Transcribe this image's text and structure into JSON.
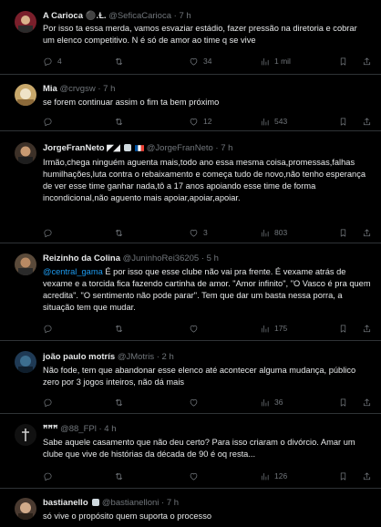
{
  "tweets": [
    {
      "name": "A Carioca",
      "name_suffix": "⚫.Ɫ.",
      "handle": "@SeficaCarioca",
      "time": "7 h",
      "text": "Por isso ta essa merda, vamos esvaziar estádio, fazer pressão na diretoria e cobrar um elenco competitivo. N é só de amor ao time q se vive",
      "replies": "4",
      "retweets": "",
      "likes": "34",
      "views": "1 mil"
    },
    {
      "name": "Mia",
      "name_suffix": "",
      "handle": "@crvgsw",
      "time": "7 h",
      "text": "se forem continuar assim o fim ta bem próximo",
      "replies": "",
      "retweets": "",
      "likes": "12",
      "views": "543"
    },
    {
      "name": "JorgeFranNeto",
      "name_suffix": "◤◢",
      "handle": "@JorgeFranNeto",
      "time": "7 h",
      "text": "Irmão,chega ninguém aguenta mais,todo ano essa mesma coisa,promessas,falhas humilhações,luta contra o rebaixamento e começa tudo de novo,não tenho esperança de ver esse time ganhar nada,tô a 17 anos apoiando esse time de forma incondicional,não aguento mais apoiar,apoiar,apoiar.",
      "replies": "",
      "retweets": "",
      "likes": "3",
      "views": "803"
    },
    {
      "name": "Reizinho da Colina",
      "name_suffix": "",
      "handle": "@JuninhoRei36205",
      "time": "5 h",
      "mention": "@central_gama",
      "text": " É por isso que esse clube não vai pra frente. É vexame atrás de vexame e a torcida fica fazendo cartinha de amor. \"Amor infinito\", \"O Vasco é pra quem acredita\". \"O sentimento não pode parar\". Tem que dar um basta nessa porra, a situação tem que mudar.",
      "replies": "",
      "retweets": "",
      "likes": "",
      "views": "175"
    },
    {
      "name": "joão paulo motrís",
      "name_suffix": "",
      "handle": "@JMotris",
      "time": "2 h",
      "text": "Não fode, tem que abandonar esse elenco até acontecer alguma mudança, público zero por 3 jogos inteiros, não dá mais",
      "replies": "",
      "retweets": "",
      "likes": "",
      "views": "36"
    },
    {
      "name": "ꟸꟸꟸ",
      "name_suffix": "",
      "handle": "@88_FPl",
      "time": "4 h",
      "text": "Sabe aquele casamento que não deu certo? Para isso criaram o divórcio. Amar um clube que vive de histórias da década de 90 é oq resta...",
      "replies": "",
      "retweets": "",
      "likes": "",
      "views": "126"
    },
    {
      "name": "bastianello",
      "name_suffix": "",
      "handle": "@bastianelloni",
      "time": "7 h",
      "text": "só vive o propósito quem suporta o processo",
      "replies": "",
      "retweets": "",
      "likes": "",
      "views": ""
    }
  ],
  "colors": {
    "background": "#000000",
    "text": "#e7e9ea",
    "muted": "#71767b",
    "link": "#1d9bf0",
    "divider": "#2f3336"
  },
  "icons": [
    "reply-icon",
    "retweet-icon",
    "like-icon",
    "views-icon",
    "bookmark-icon",
    "share-icon"
  ]
}
